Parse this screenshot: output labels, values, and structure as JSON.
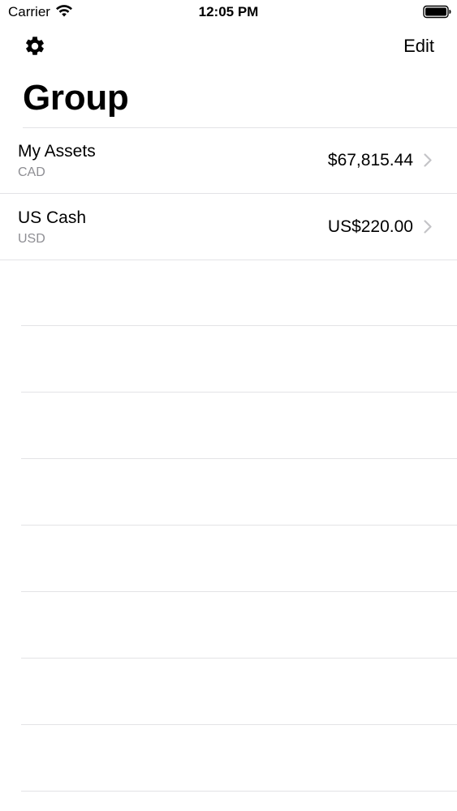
{
  "status_bar": {
    "carrier": "Carrier",
    "time": "12:05 PM"
  },
  "nav": {
    "settings_icon": "gear-icon",
    "edit_label": "Edit",
    "title": "Group"
  },
  "accounts": [
    {
      "name": "My Assets",
      "currency": "CAD",
      "balance": "$67,815.44"
    },
    {
      "name": "US Cash",
      "currency": "USD",
      "balance": "US$220.00"
    }
  ],
  "colors": {
    "separator": "#e3e3e6",
    "secondary_text": "#8e8e93",
    "chevron": "#c4c4c7"
  }
}
